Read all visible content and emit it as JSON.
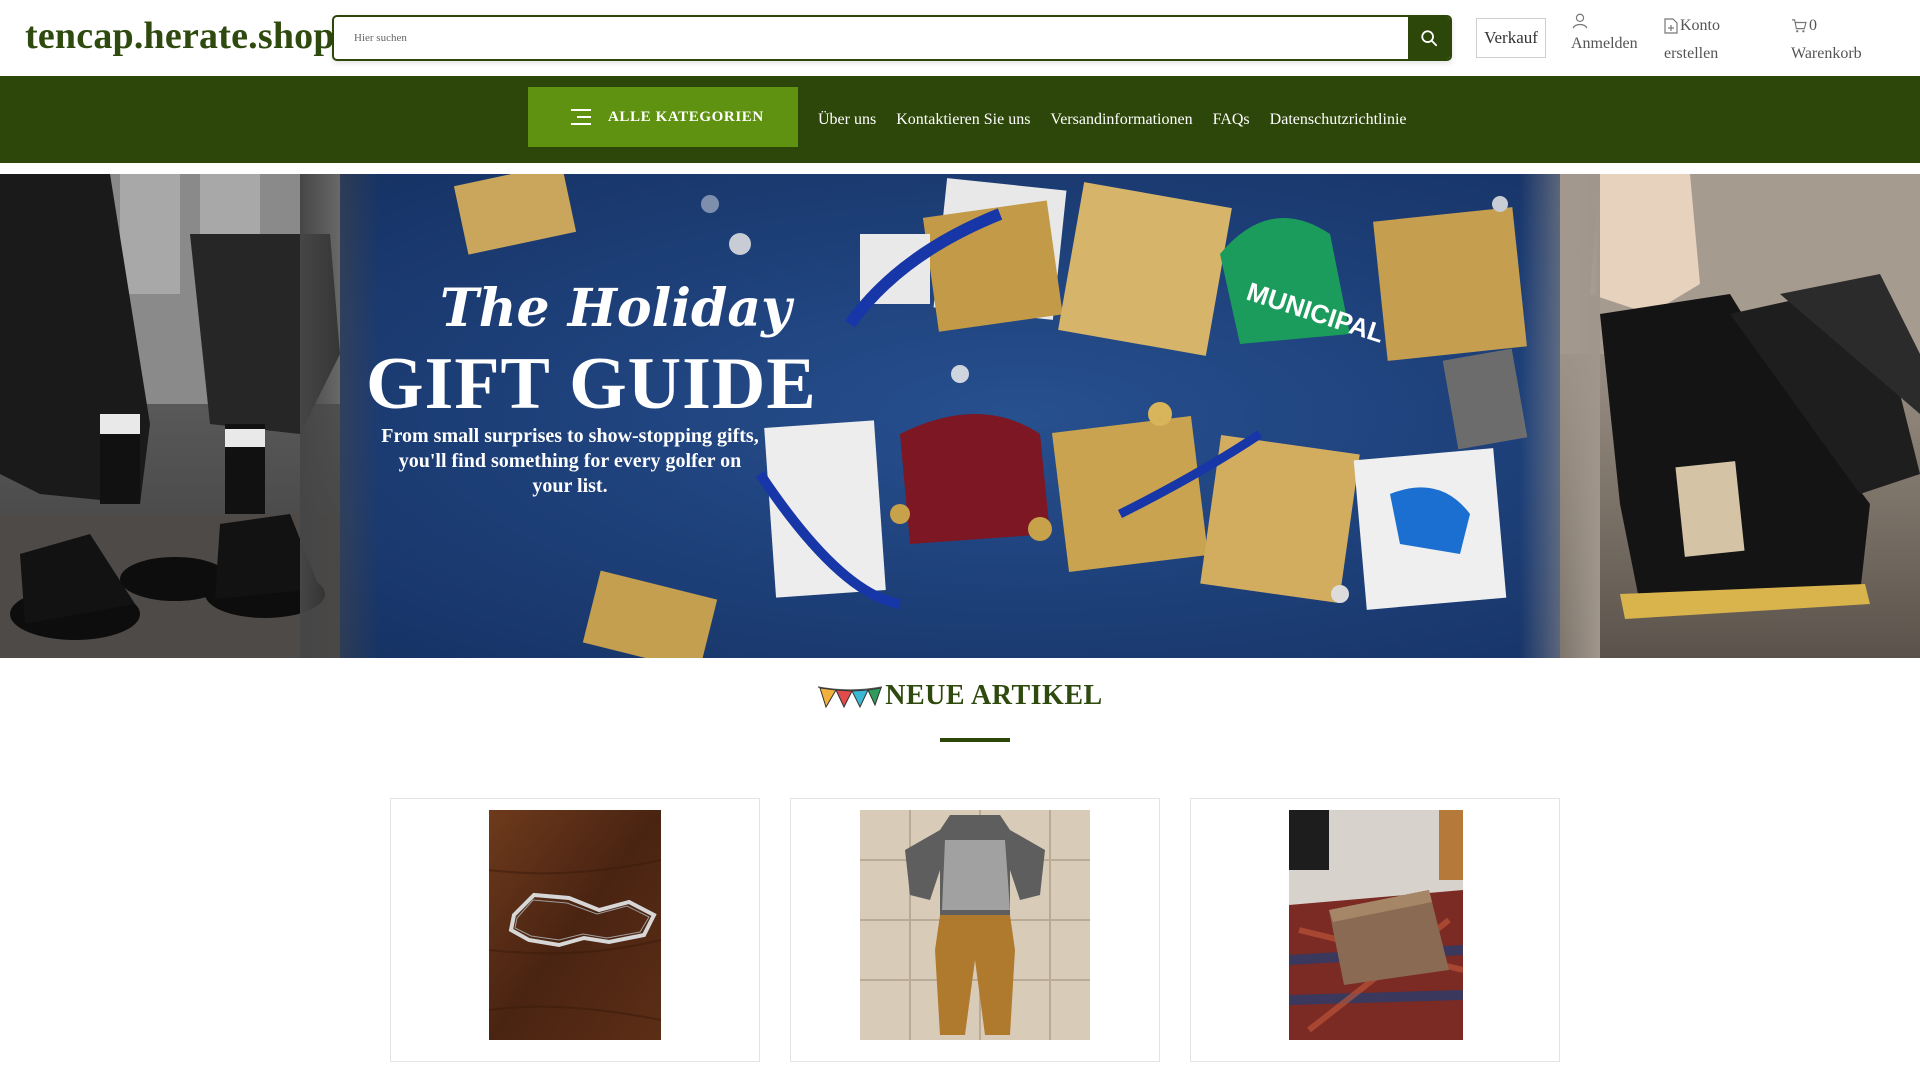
{
  "header": {
    "logo": "tencap.herate.shop",
    "search_placeholder": "Hier suchen",
    "sell_label": "Verkauf",
    "login_label": "Anmelden",
    "account_line1": "Konto",
    "account_line2": "erstellen",
    "cart_count": "0",
    "cart_label": "Warenkorb"
  },
  "nav": {
    "categories_label": "ALLE KATEGORIEN",
    "links": [
      "Über uns",
      "Kontaktieren Sie uns",
      "Versandinformationen",
      "FAQs",
      "Datenschutzrichtlinie"
    ]
  },
  "banner": {
    "title_line1": "The Holiday",
    "title_line2": "GIFT GUIDE",
    "subtitle": "From small surprises to show-stopping gifts, you'll find something for every golfer on your list."
  },
  "section": {
    "title": "NEUE ARTIKEL"
  },
  "products": [
    {
      "image": "bracelet"
    },
    {
      "image": "ski-suit"
    },
    {
      "image": "wooden-board"
    }
  ],
  "colors": {
    "brand_dark": "#2d4609",
    "brand_green": "#5f9210"
  }
}
